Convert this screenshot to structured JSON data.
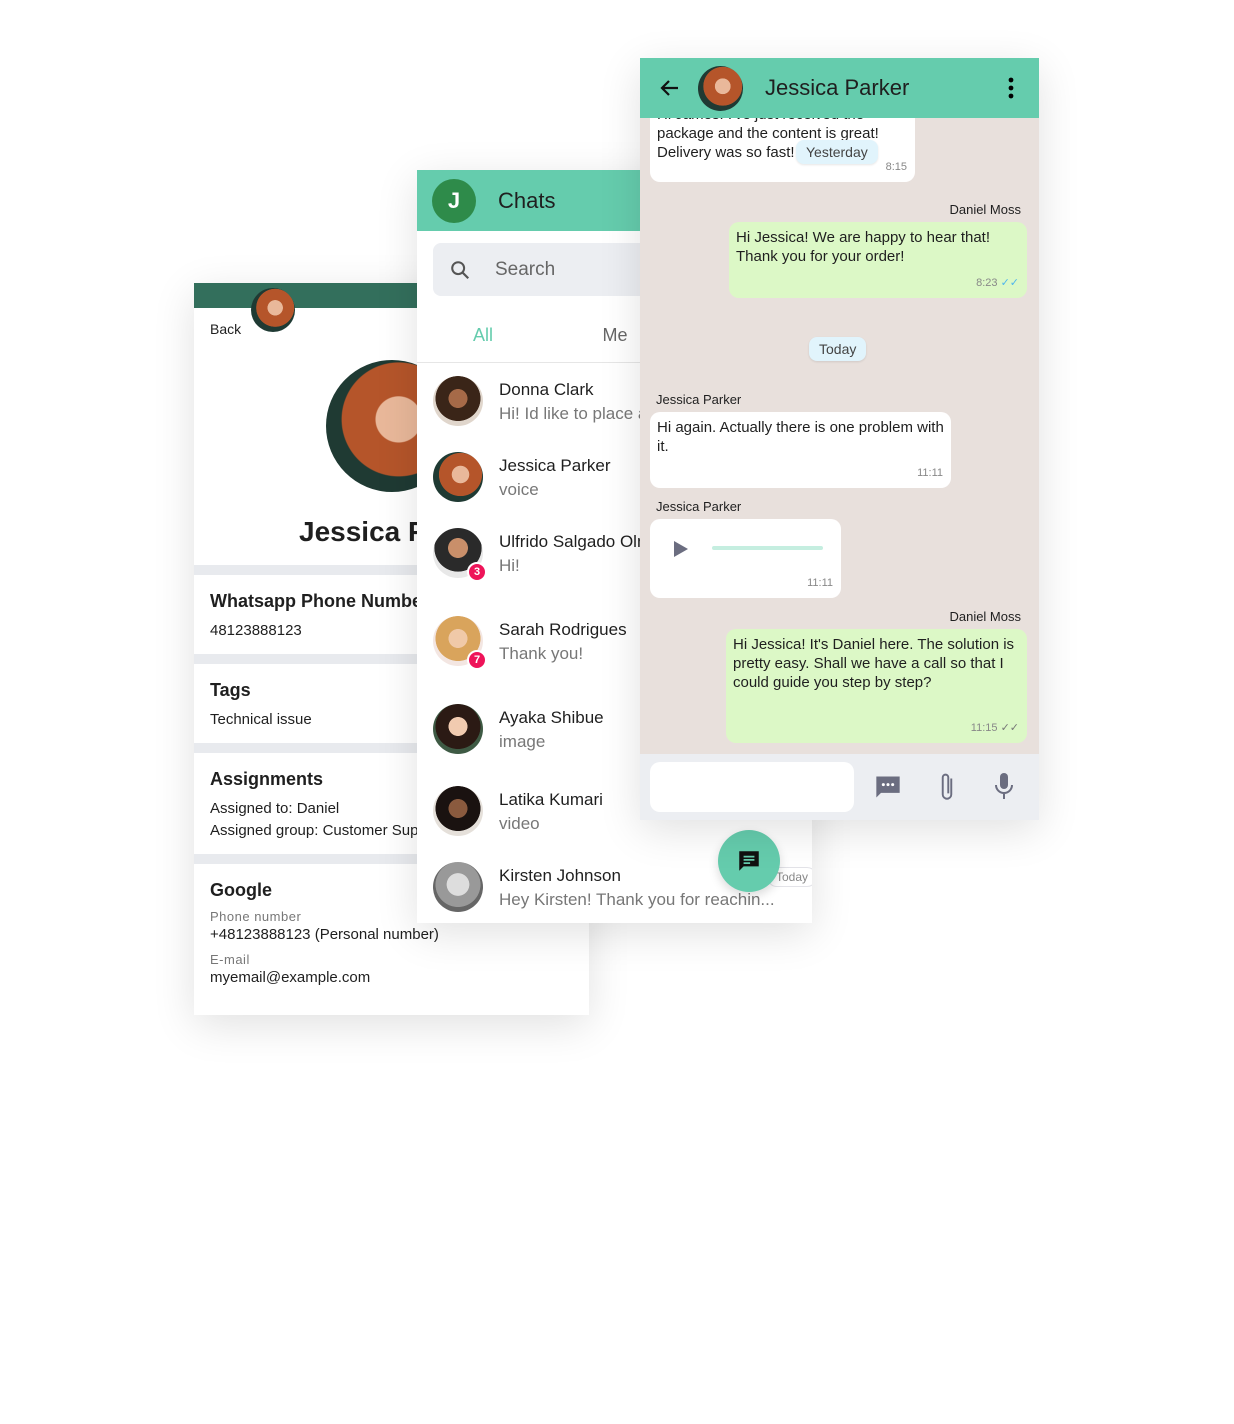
{
  "colors": {
    "accent": "#65ccad",
    "dark_header": "#336f5c",
    "badge": "#ee1459",
    "outgoing_bubble": "#dcf8c6",
    "chat_bg": "#e8e0dc",
    "date_chip": "#e1f4fc"
  },
  "contact": {
    "back_label": "Back",
    "name": "Jessica Parker",
    "sections": [
      {
        "title": "Whatsapp Phone Number",
        "lines": [
          "48123888123"
        ]
      },
      {
        "title": "Tags",
        "lines": [
          "Technical issue"
        ]
      },
      {
        "title": "Assignments",
        "lines": [
          "Assigned to: Daniel",
          "Assigned group: Customer Support"
        ]
      }
    ],
    "google": {
      "title": "Google",
      "phone_label": "Phone number",
      "phone": "+48123888123 (Personal number)",
      "email_label": "E-mail",
      "email": "myemail@example.com"
    }
  },
  "chats": {
    "user_initial": "J",
    "title": "Chats",
    "search_placeholder": "Search",
    "tabs": [
      "All",
      "Me"
    ],
    "items": [
      {
        "name": "Donna Clark",
        "message": "Hi! Id like to place an order",
        "avatar": "d"
      },
      {
        "name": "Jessica Parker",
        "message": "voice",
        "avatar": ""
      },
      {
        "name": "Ulfrido Salgado Olmos",
        "message": "Hi!",
        "badge": "3",
        "avatar": "m"
      },
      {
        "name": "Sarah Rodrigues",
        "message": "Thank you!",
        "badge": "7",
        "avatar": "s"
      },
      {
        "name": "Ayaka Shibue",
        "message": "image",
        "avatar": "a"
      },
      {
        "name": "Latika Kumari",
        "message": "video",
        "avatar": "l"
      },
      {
        "name": "Kirsten Johnson",
        "message": "Hey Kirsten! Thank you for reachin...",
        "date": "Today",
        "avatar": "g"
      }
    ],
    "fab_icon": "chat-icon"
  },
  "conversation": {
    "title": "Jessica Parker",
    "messages": [
      {
        "text": "Hi James! I've just received the package and the content is great! Delivery was so fast!",
        "time": "8:15"
      },
      {
        "sender": "Daniel Moss",
        "text": "Hi Jessica! We are happy to hear that! Thank you for your order!",
        "time": "8:23"
      },
      {
        "sender": "Jessica Parker",
        "text": "Hi again. Actually there is one problem with it.",
        "time": "11:11"
      },
      {
        "sender": "Jessica Parker",
        "type": "voice",
        "time": "11:11"
      },
      {
        "sender": "Daniel Moss",
        "text": "Hi Jessica! It's Daniel here. The solution is pretty easy. Shall we have a call so that I could guide you step by step?",
        "time": "11:15"
      }
    ],
    "date_chips": [
      "Yesterday",
      "Today"
    ]
  }
}
